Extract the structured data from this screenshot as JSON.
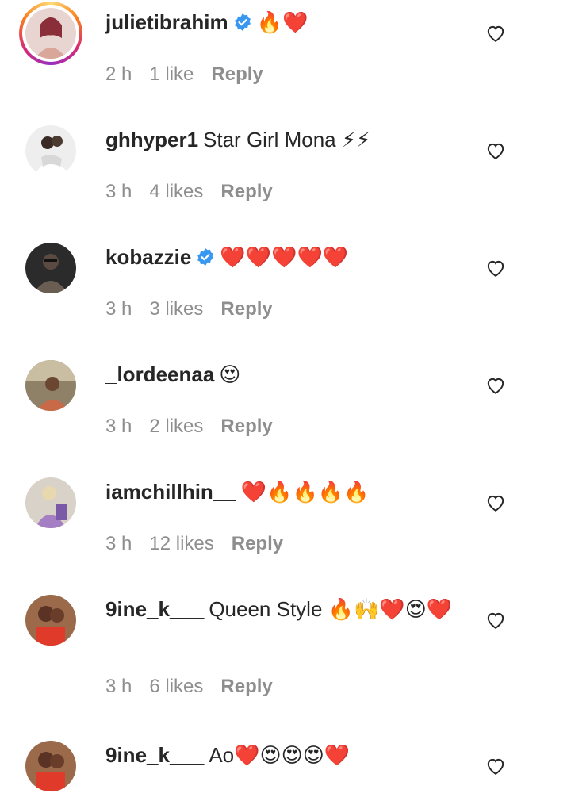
{
  "comments": [
    {
      "username": "julietibrahim",
      "verified": true,
      "story_ring": true,
      "text": "🔥❤️",
      "time": "2 h",
      "likes": "1 like",
      "reply": "Reply",
      "avatar_color": "#c46a6a"
    },
    {
      "username": "ghhyper1",
      "verified": false,
      "text": "Star Girl Mona ⚡⚡",
      "time": "3 h",
      "likes": "4 likes",
      "reply": "Reply",
      "avatar_color": "#d9d9d9"
    },
    {
      "username": "kobazzie",
      "verified": true,
      "text": "❤️❤️❤️❤️❤️",
      "time": "3 h",
      "likes": "3 likes",
      "reply": "Reply",
      "avatar_color": "#3a3a3a"
    },
    {
      "username": "_lordeenaa",
      "verified": false,
      "text": "😍",
      "time": "3 h",
      "likes": "2 likes",
      "reply": "Reply",
      "avatar_color": "#7a6a55"
    },
    {
      "username": "iamchillhin__",
      "verified": false,
      "text": "❤️🔥🔥🔥🔥",
      "time": "3 h",
      "likes": "12 likes",
      "reply": "Reply",
      "avatar_color": "#b9a9c6"
    },
    {
      "username": "9ine_k___",
      "verified": false,
      "text": "Queen Style 🔥🙌❤️😍❤️",
      "time": "3 h",
      "likes": "6 likes",
      "reply": "Reply",
      "avatar_color": "#b85a3c"
    },
    {
      "username": "9ine_k___",
      "verified": false,
      "text": "Ao❤️😍😍😍❤️",
      "time": "",
      "likes": "",
      "reply": "",
      "avatar_color": "#b85a3c"
    }
  ],
  "icons": {
    "verified": "verified-badge-icon",
    "like": "heart-outline-icon"
  },
  "colors": {
    "verified_blue": "#3897f0",
    "meta_gray": "#8e8e8e",
    "text": "#262626"
  }
}
